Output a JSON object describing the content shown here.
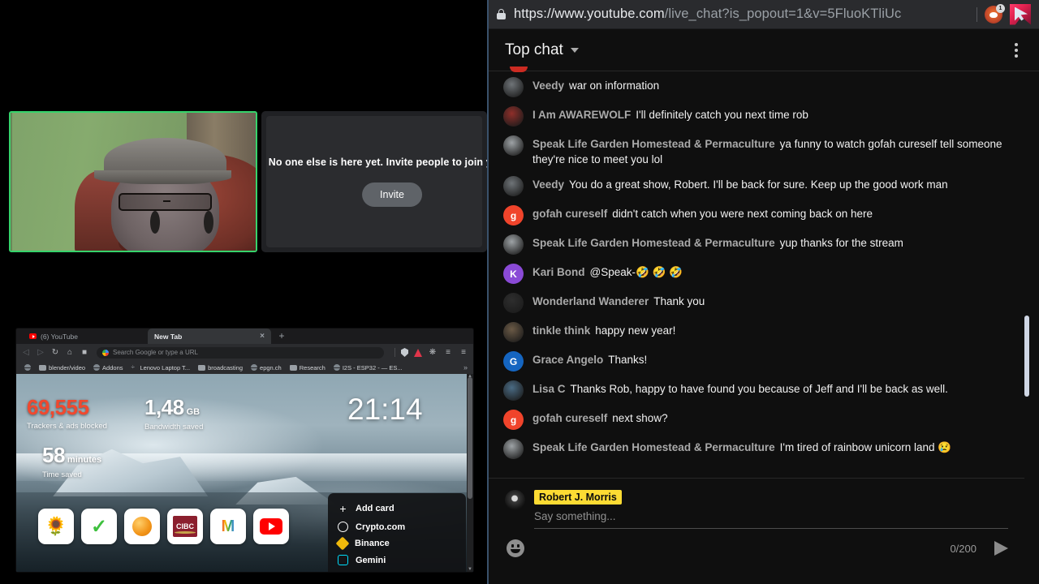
{
  "browser_popout": {
    "url_prefix": "https://www.youtube.com",
    "url_suffix": "/live_chat?is_popout=1&v=5FluoKTliUc",
    "lock_icon": "lock-icon",
    "brave_icon": "brave-lion-icon",
    "brave_badge": "1",
    "cursor_icon": "pink-cursor-icon"
  },
  "chat": {
    "header": {
      "mode_label": "Top chat",
      "caret_icon": "chevron-down-icon",
      "menu_icon": "kebab-menu-icon"
    },
    "messages": [
      {
        "author": "Veedy",
        "text": "war on information",
        "avatar_type": "photo",
        "avatar_color": "#6f7478",
        "initial": ""
      },
      {
        "author": "I Am AWAREWOLF",
        "text": "I'll definitely catch you next time rob",
        "avatar_type": "photo",
        "avatar_color": "#8f2f2a",
        "initial": ""
      },
      {
        "author": "Speak Life Garden Homestead & Permaculture",
        "text": "ya funny to watch gofah cureself tell someone they're nice to meet you lol",
        "avatar_type": "photo",
        "avatar_color": "#9ea3a6",
        "initial": ""
      },
      {
        "author": "Veedy",
        "text": "You do a great show, Robert. I'll be back for sure. Keep up the good work man",
        "avatar_type": "photo",
        "avatar_color": "#6f7478",
        "initial": ""
      },
      {
        "author": "gofah cureself",
        "text": "didn't catch when you were next coming back on here",
        "avatar_type": "initial",
        "avatar_color": "#f0442b",
        "initial": "g"
      },
      {
        "author": "Speak Life Garden Homestead & Permaculture",
        "text": "yup thanks for the stream",
        "avatar_type": "photo",
        "avatar_color": "#9ea3a6",
        "initial": ""
      },
      {
        "author": "Kari Bond",
        "text": "@Speak-🤣 🤣 🤣",
        "avatar_type": "initial",
        "avatar_color": "#8a4ad6",
        "initial": "K"
      },
      {
        "author": "Wonderland Wanderer",
        "text": "Thank you",
        "avatar_type": "photo",
        "avatar_color": "#2e2e2e",
        "initial": ""
      },
      {
        "author": "tinkle think",
        "text": "happy new year!",
        "avatar_type": "photo",
        "avatar_color": "#6b5a46",
        "initial": ""
      },
      {
        "author": "Grace Angelo",
        "text": "Thanks!",
        "avatar_type": "initial",
        "avatar_color": "#1565c0",
        "initial": "G"
      },
      {
        "author": "Lisa C",
        "text": "Thanks Rob, happy to have found you because of Jeff and I'll be back as well.",
        "avatar_type": "photo",
        "avatar_color": "#4a6b84",
        "initial": ""
      },
      {
        "author": "gofah cureself",
        "text": "next show?",
        "avatar_type": "initial",
        "avatar_color": "#f0442b",
        "initial": "g"
      },
      {
        "author": "Speak Life Garden Homestead & Permaculture",
        "text": "I'm tired of rainbow unicorn land 😢",
        "avatar_type": "photo",
        "avatar_color": "#9ea3a6",
        "initial": ""
      }
    ],
    "input": {
      "user_name": "Robert J. Morris",
      "placeholder": "Say something...",
      "counter": "0/200",
      "emoji_icon": "emoji-smiley-icon",
      "send_icon": "send-arrow-icon",
      "name_highlight_color": "#fcdb33"
    }
  },
  "meeting": {
    "empty_message": "No one else is here yet. Invite people to join you",
    "invite_label": "Invite"
  },
  "webcam": {
    "border_color": "#36d36b"
  },
  "embedded_browser": {
    "tabs": [
      {
        "label": "(6) YouTube",
        "active": false,
        "favicon": "youtube-icon"
      },
      {
        "label": "New Tab",
        "active": true,
        "favicon": "none"
      }
    ],
    "new_tab_button": "+",
    "close_icon": "×",
    "omnibox": {
      "placeholder": "Search Google or type a URL",
      "search_icon": "google-icon"
    },
    "nav": {
      "back_icon": "back-arrow-icon",
      "forward_icon": "forward-arrow-icon",
      "reload_icon": "reload-icon",
      "home_icon": "home-icon",
      "bookmark_icon": "bookmark-icon",
      "shield_icon": "brave-shield-icon",
      "brave_icon": "brave-triangle-icon",
      "extensions_icon": "puzzle-icon",
      "reading_list_icon": "reading-list-icon",
      "menu_icon": "hamburger-menu-icon"
    },
    "bookmarks": [
      {
        "label": "",
        "icon": "globe-icon"
      },
      {
        "label": "blender/video",
        "icon": "folder-icon"
      },
      {
        "label": "Addons",
        "icon": "globe-icon"
      },
      {
        "label": "Lenovo Laptop T...",
        "icon": "dash-icon"
      },
      {
        "label": "broadcasting",
        "icon": "folder-icon"
      },
      {
        "label": "epgn.ch",
        "icon": "globe-icon"
      },
      {
        "label": "Research",
        "icon": "folder-icon"
      },
      {
        "label": "I2S - ESP32 - — ES...",
        "icon": "globe-icon"
      }
    ],
    "bookmarks_overflow": "»",
    "new_tab_page": {
      "stats": [
        {
          "value": "69,555",
          "unit": "",
          "caption": "Trackers & ads blocked",
          "color": "#f1482e"
        },
        {
          "value": "1,48",
          "unit": "GB",
          "caption": "Bandwidth saved",
          "color": "#ffffff"
        },
        {
          "value": "58",
          "unit": "minutes",
          "caption": "Time saved",
          "color": "#ffffff"
        }
      ],
      "clock": "21:14",
      "shortcuts": [
        {
          "name": "curl-shortcut",
          "icon": "curl-icon"
        },
        {
          "name": "checkmark-shortcut",
          "icon": "green-check-icon"
        },
        {
          "name": "orange-shortcut",
          "icon": "orange-sphere-icon"
        },
        {
          "name": "cibc-shortcut",
          "icon": "cibc-icon",
          "label": "CIBC"
        },
        {
          "name": "gmail-shortcut",
          "icon": "gmail-icon",
          "label": "M"
        },
        {
          "name": "youtube-shortcut",
          "icon": "youtube-icon"
        }
      ],
      "crypto_card": {
        "add_card_label": "Add card",
        "items": [
          {
            "label": "Crypto.com",
            "icon": "crypto-com-icon"
          },
          {
            "label": "Binance",
            "icon": "binance-icon"
          },
          {
            "label": "Gemini",
            "icon": "gemini-icon"
          }
        ]
      }
    }
  }
}
